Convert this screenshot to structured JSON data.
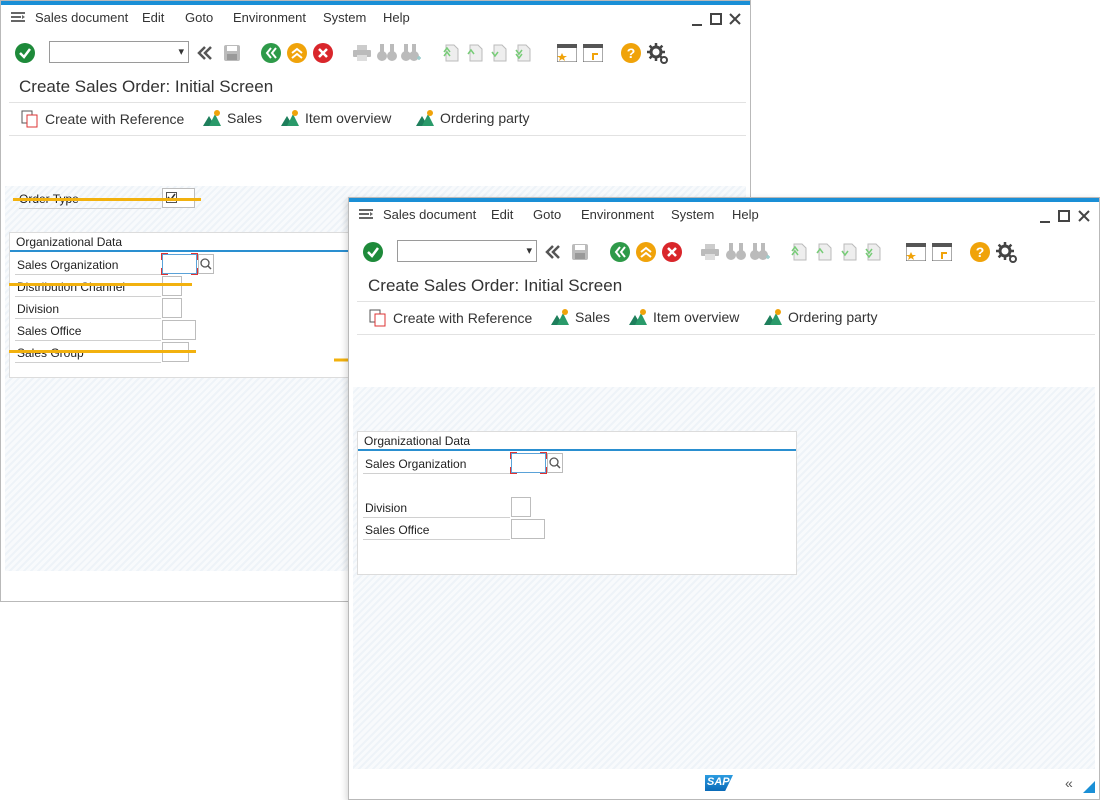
{
  "menu": {
    "items": [
      "Sales document",
      "Edit",
      "Goto",
      "Environment",
      "System",
      "Help"
    ]
  },
  "screen": {
    "title": "Create Sales Order: Initial Screen"
  },
  "app_toolbar": {
    "create_with_reference": "Create with Reference",
    "sales": "Sales",
    "item_overview": "Item overview",
    "ordering_party": "Ordering party"
  },
  "before": {
    "order_type_label": "Order Type",
    "org_data_title": "Organizational Data",
    "fields": [
      "Sales Organization",
      "Distribution Channel",
      "Division",
      "Sales Office",
      "Sales Group"
    ]
  },
  "after": {
    "org_data_title": "Organizational Data",
    "fields": [
      "Sales Organization",
      "Division",
      "Sales Office"
    ]
  },
  "footer": {
    "logo": "SAP",
    "collapse": "«"
  },
  "colors": {
    "accent_blue": "#1a8fd6",
    "highlight_orange": "#f2b10e",
    "ok_green": "#1e8a3a",
    "back_green": "#2e9a49",
    "exit_yellow": "#f0a30a",
    "cancel_red": "#d9262b",
    "help_orange": "#f0a30a"
  }
}
